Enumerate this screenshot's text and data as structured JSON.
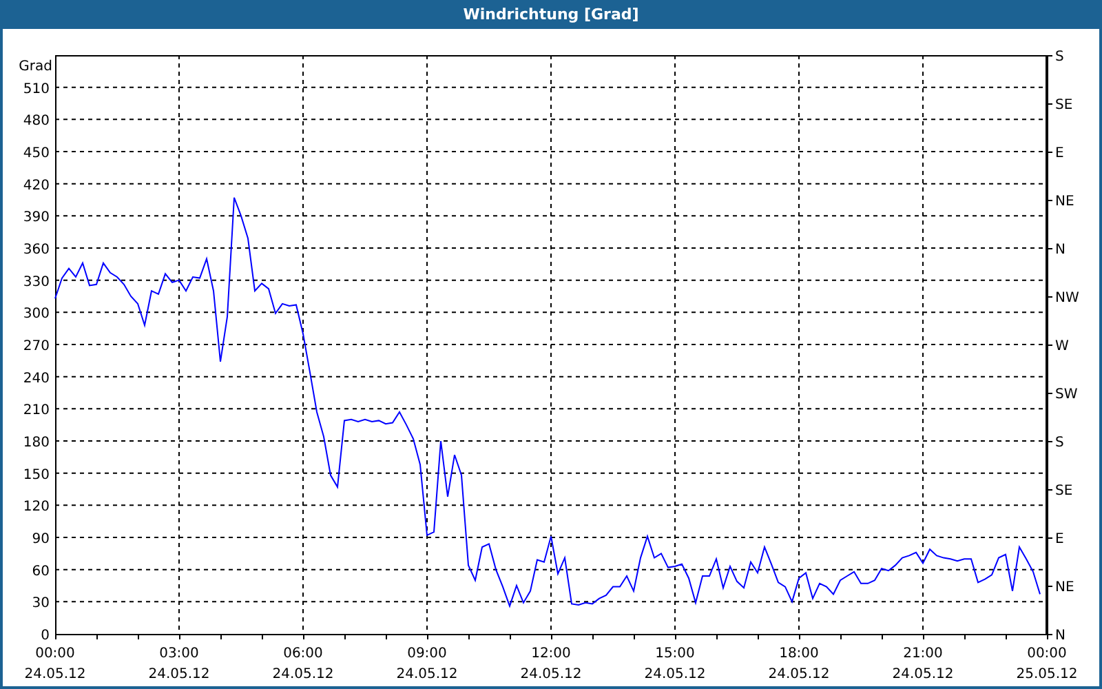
{
  "window": {
    "title": "Windrichtung [Grad]"
  },
  "chart": {
    "chart_data": {
      "type": "line",
      "ylabel": "Grad",
      "grid": true,
      "ylim": [
        0,
        540
      ],
      "yticks": [
        0,
        30,
        60,
        90,
        120,
        150,
        180,
        210,
        240,
        270,
        300,
        330,
        360,
        390,
        420,
        450,
        480,
        510
      ],
      "categories": [
        "00:00\n24.05.12",
        null,
        null,
        null,
        null,
        null,
        null,
        null,
        null,
        null,
        null,
        null,
        null,
        null,
        null,
        null,
        null,
        null,
        "03:00\n24.05.12",
        null,
        null,
        null,
        null,
        null,
        null,
        null,
        null,
        null,
        null,
        null,
        null,
        null,
        null,
        null,
        null,
        null,
        "06:00\n24.05.12",
        null,
        null,
        null,
        null,
        null,
        null,
        null,
        null,
        null,
        null,
        null,
        null,
        null,
        null,
        null,
        null,
        null,
        "09:00\n24.05.12",
        null,
        null,
        null,
        null,
        null,
        null,
        null,
        null,
        null,
        null,
        null,
        null,
        null,
        null,
        null,
        null,
        null,
        "12:00\n24.05.12",
        null,
        null,
        null,
        null,
        null,
        null,
        null,
        null,
        null,
        null,
        null,
        null,
        null,
        null,
        null,
        null,
        null,
        "15:00\n24.05.12",
        null,
        null,
        null,
        null,
        null,
        null,
        null,
        null,
        null,
        null,
        null,
        null,
        null,
        null,
        null,
        null,
        null,
        "18:00\n24.05.12",
        null,
        null,
        null,
        null,
        null,
        null,
        null,
        null,
        null,
        null,
        null,
        null,
        null,
        null,
        null,
        null,
        null,
        "21:00\n24.05.12",
        null,
        null,
        null,
        null,
        null,
        null,
        null,
        null,
        null,
        null,
        null,
        null,
        null,
        null,
        null,
        null,
        null,
        "00:00\n25.05.12"
      ],
      "series": [
        {
          "color": "#0000ff",
          "values": [
            313,
            332,
            341,
            333,
            346,
            325,
            326,
            346,
            337,
            333,
            326,
            315,
            308,
            288,
            320,
            317,
            336,
            328,
            330,
            320,
            333,
            332,
            350,
            320,
            254,
            296,
            407,
            390,
            369,
            320,
            327,
            322,
            299,
            308,
            306,
            307,
            280,
            244,
            207,
            184,
            148,
            137,
            199,
            200,
            198,
            200,
            198,
            199,
            196,
            197,
            207,
            195,
            182,
            158,
            92,
            95,
            180,
            128,
            167,
            148,
            64,
            50,
            81,
            84,
            60,
            44,
            26,
            45,
            29,
            40,
            69,
            67,
            91,
            56,
            71,
            28,
            27,
            29,
            28,
            33,
            36,
            44,
            44,
            54,
            40,
            71,
            91,
            71,
            75,
            62,
            63,
            65,
            52,
            29,
            54,
            54,
            70,
            43,
            63,
            49,
            43,
            67,
            57,
            81,
            65,
            48,
            44,
            30,
            52,
            57,
            33,
            47,
            44,
            37,
            50,
            54,
            58,
            47,
            47,
            50,
            61,
            59,
            64,
            71,
            73,
            76,
            66,
            79,
            73,
            71,
            70,
            68,
            70,
            70,
            48,
            51,
            55,
            71,
            74,
            40,
            81,
            70,
            58,
            37,
            null
          ]
        }
      ]
    },
    "compass_labels": [
      "S",
      "SE",
      "E",
      "NE",
      "N",
      "NW",
      "W",
      "SW",
      "S",
      "SE",
      "E",
      "NE",
      "N"
    ]
  }
}
